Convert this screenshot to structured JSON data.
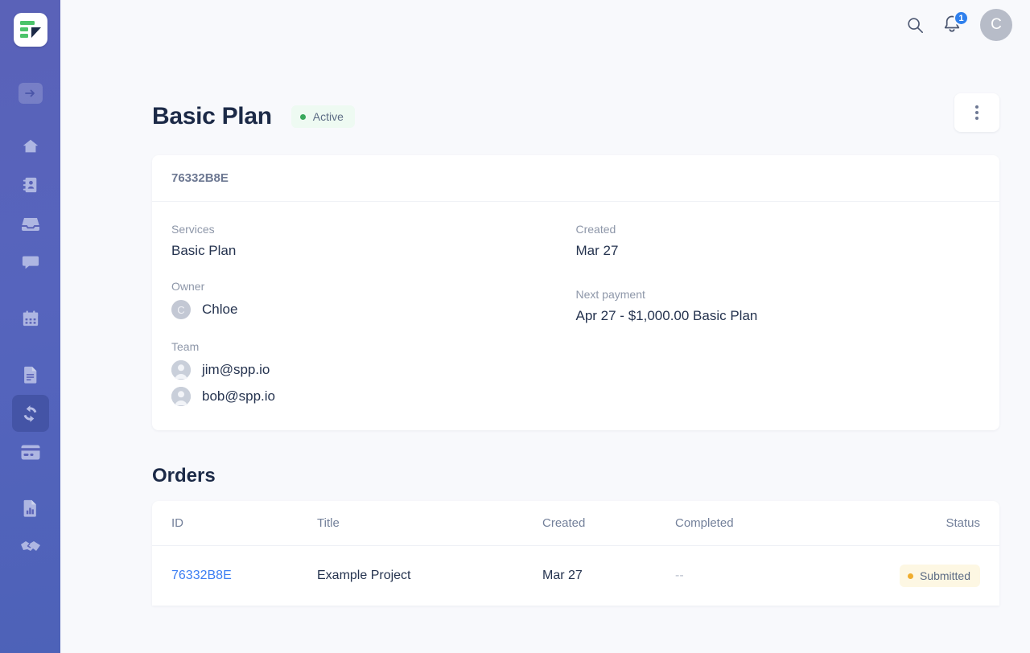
{
  "sidebar": {
    "logo": "spp-logo-icon",
    "toggle": {
      "name": "collapse-sidebar-button",
      "icon": "arrow-right-icon"
    },
    "items": [
      {
        "icon": "home-icon",
        "name": "home",
        "active": false
      },
      {
        "icon": "contacts-icon",
        "name": "clients",
        "active": false
      },
      {
        "icon": "inbox-icon",
        "name": "inbox",
        "active": false
      },
      {
        "icon": "chat-icon",
        "name": "messages",
        "active": false
      },
      {
        "icon": "calendar-icon",
        "name": "calendar",
        "active": false
      },
      {
        "icon": "document-icon",
        "name": "orders",
        "active": false
      },
      {
        "icon": "refresh-icon",
        "name": "subscriptions",
        "active": true
      },
      {
        "icon": "credit-card-icon",
        "name": "invoices",
        "active": false
      },
      {
        "icon": "report-icon",
        "name": "reports",
        "active": false
      },
      {
        "icon": "handshake-icon",
        "name": "affiliates",
        "active": false
      }
    ]
  },
  "topbar": {
    "search_icon": "search-icon",
    "notifications_icon": "bell-icon",
    "notifications_count": "1",
    "avatar_initial": "C"
  },
  "page": {
    "title": "Basic Plan",
    "status": {
      "label": "Active",
      "dot_color": "#38a85b",
      "bg_color": "#eefaf2"
    },
    "menu_button": "more-options-button"
  },
  "detail_card": {
    "id": "76332B8E",
    "fields": {
      "services_label": "Services",
      "services_value": "Basic Plan",
      "created_label": "Created",
      "created_value": "Mar 27",
      "owner_label": "Owner",
      "owner_name": "Chloe",
      "owner_initial": "C",
      "next_payment_label": "Next payment",
      "next_payment_value": "Apr 27 - $1,000.00 Basic Plan",
      "team_label": "Team",
      "team": [
        {
          "email": "jim@spp.io"
        },
        {
          "email": "bob@spp.io"
        }
      ]
    }
  },
  "orders": {
    "title": "Orders",
    "columns": [
      "ID",
      "Title",
      "Created",
      "Completed",
      "Status"
    ],
    "rows": [
      {
        "id": "76332B8E",
        "title": "Example Project",
        "created": "Mar 27",
        "completed": "--",
        "status": "Submitted",
        "status_dot_color": "#f0ad2e",
        "status_bg_color": "#fdf7e3"
      }
    ]
  }
}
